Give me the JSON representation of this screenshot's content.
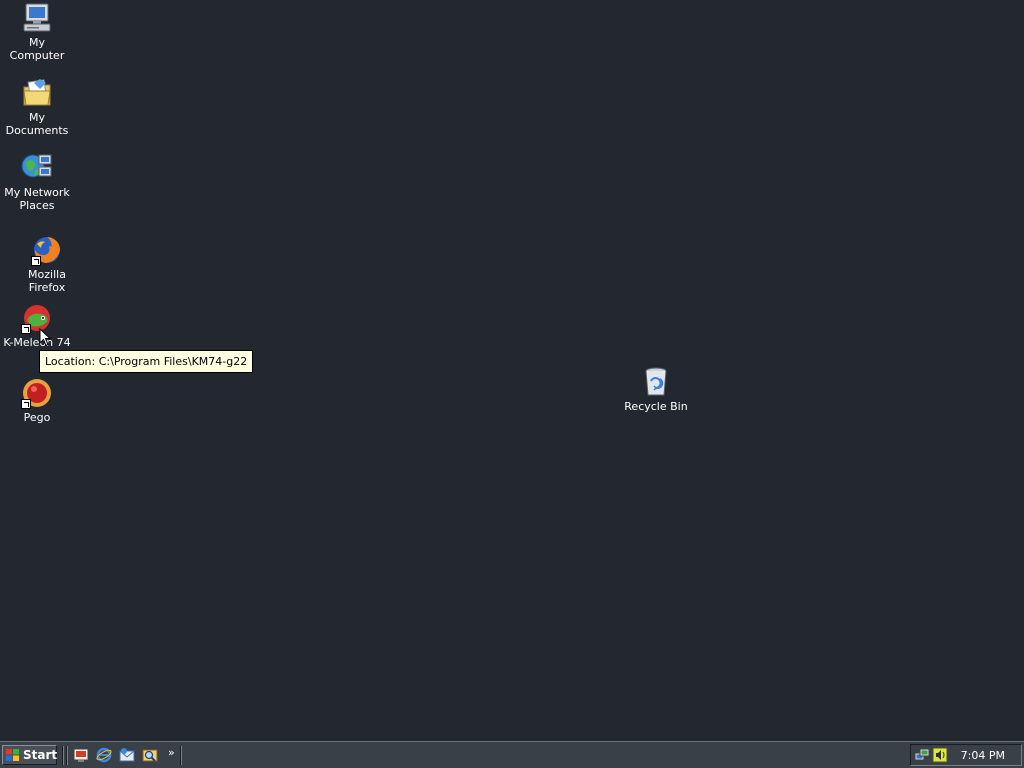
{
  "desktop": {
    "icons": [
      {
        "label": "My Computer",
        "icon": "my-computer-icon"
      },
      {
        "label": "My Documents",
        "icon": "my-documents-icon"
      },
      {
        "label": "My Network Places",
        "icon": "network-places-icon"
      },
      {
        "label": "Mozilla Firefox",
        "icon": "firefox-icon"
      },
      {
        "label": "K-Meleon 74",
        "icon": "k-meleon-icon"
      },
      {
        "label": "Pego",
        "icon": "pego-icon"
      },
      {
        "label": "Recycle Bin",
        "icon": "recycle-bin-icon"
      }
    ],
    "tooltip": "Location: C:\\Program Files\\KM74-g22",
    "background_color": "#232830"
  },
  "taskbar": {
    "start_label": "Start",
    "quick_launch": [
      "show-desktop-icon",
      "internet-explorer-icon",
      "outlook-express-icon",
      "search-icon"
    ],
    "overflow_label": "»",
    "tray_icons": [
      "network-icon",
      "volume-icon"
    ],
    "clock": "7:04 PM"
  }
}
